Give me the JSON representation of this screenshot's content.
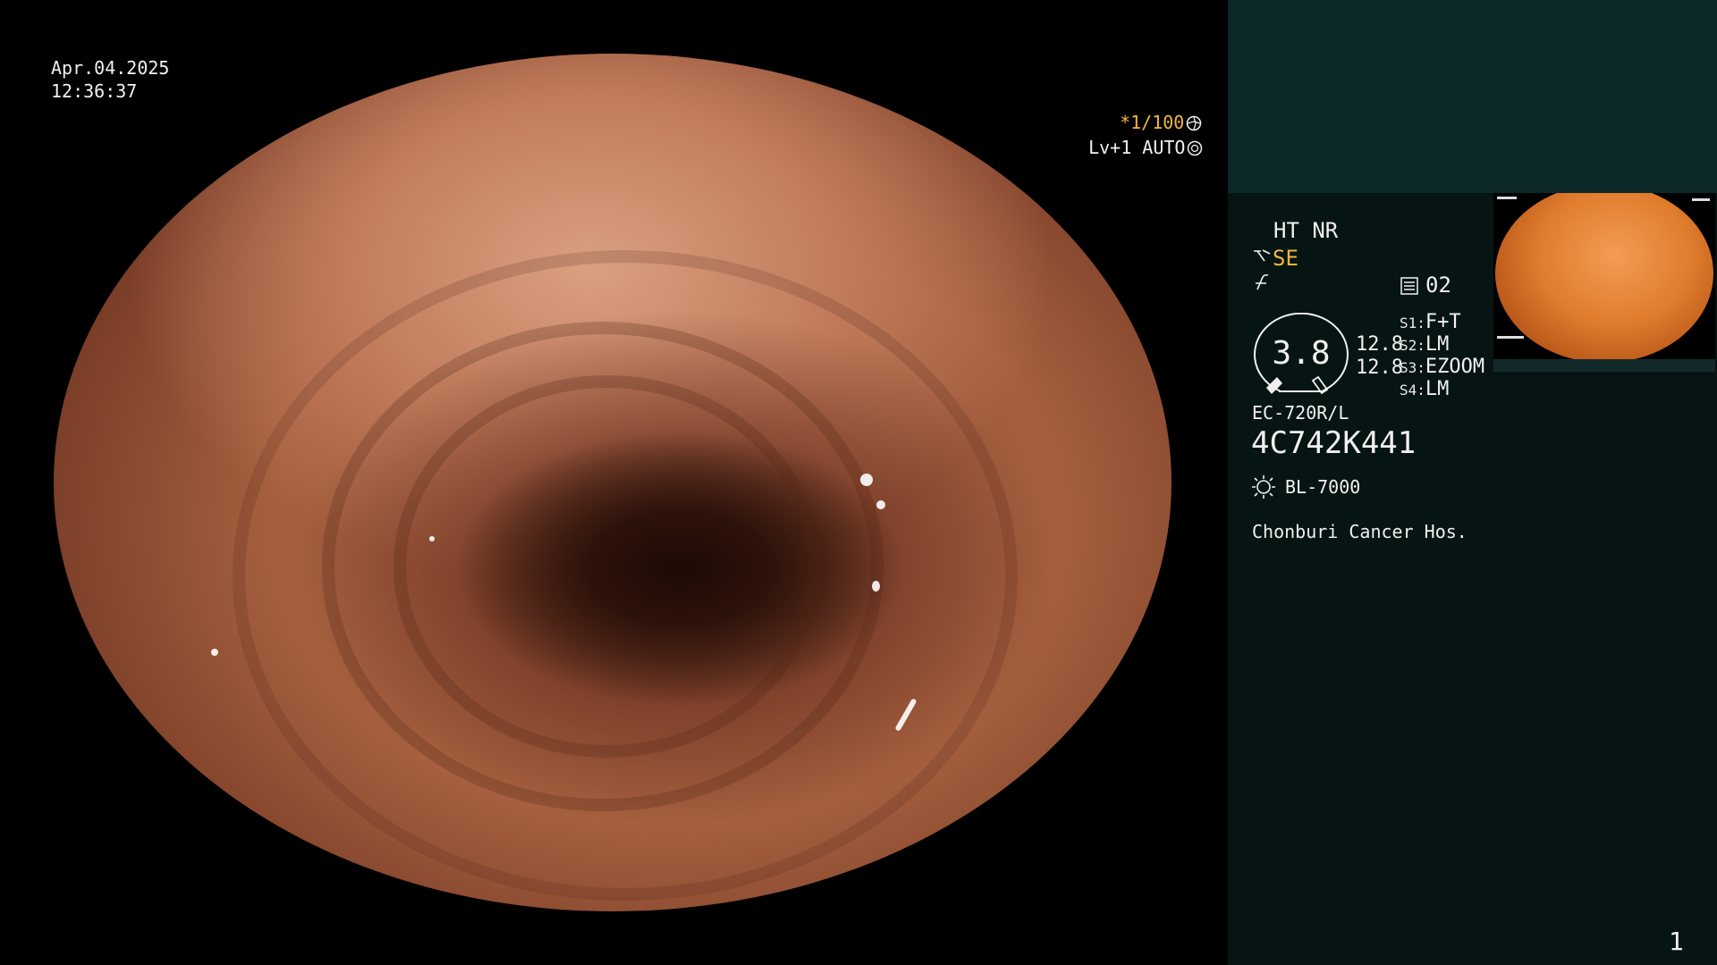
{
  "overlay": {
    "date": "Apr.04.2025",
    "time": "12:36:37",
    "zoom_ratio": "*1/100",
    "level": "Lv+1 AUTO"
  },
  "panel": {
    "enhancement": "HT NR",
    "structure_mode": "SE",
    "preset": "02",
    "gauge_value": "3.8",
    "sub_values": [
      "12.8",
      "12.8"
    ],
    "switches": [
      {
        "key": "S1:",
        "value": "F+T"
      },
      {
        "key": "S2:",
        "value": "LM"
      },
      {
        "key": "S3:",
        "value": "EZOOM"
      },
      {
        "key": "S4:",
        "value": "LM"
      }
    ],
    "scope_model": "EC-720R/L",
    "serial": "4C742K441",
    "light_source": "BL-7000",
    "hospital": "Chonburi Cancer Hos.",
    "page_number": "1"
  },
  "colors": {
    "accent_orange": "#f4b63a",
    "panel_bg": "#071414",
    "panel_top_bg": "#0c2828"
  },
  "icons": [
    "aperture-icon",
    "iris-icon",
    "structure-enhance-icon",
    "filter-icon",
    "preset-icon",
    "light-bulb-icon"
  ]
}
